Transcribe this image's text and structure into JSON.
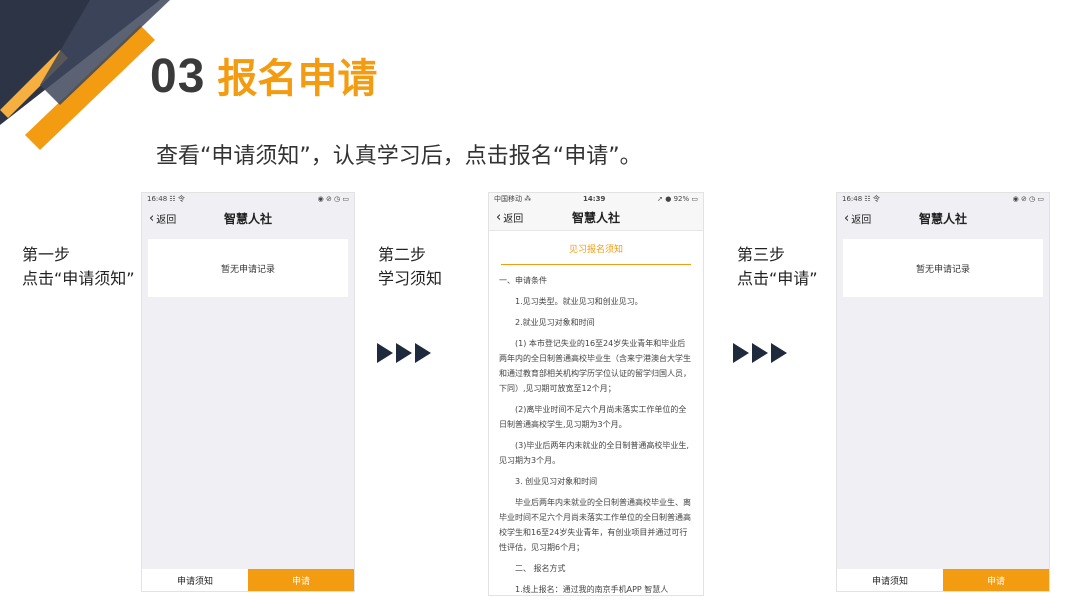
{
  "heading": {
    "number": "03",
    "title": "报名申请"
  },
  "instruction": "查看“申请须知”，认真学习后，点击报名“申请”。",
  "steps": [
    {
      "line1": "第一步",
      "line2": "点击“申请须知”"
    },
    {
      "line1": "第二步",
      "line2": "学习须知"
    },
    {
      "line1": "第三步",
      "line2": "点击“申请”"
    }
  ],
  "colors": {
    "accent": "#f39c12",
    "dark": "#2c3446",
    "text": "#333333"
  },
  "phone1": {
    "status_left": "16:48 ☷ 令",
    "status_right": "◉ ⊘ ◷ ▭",
    "back_label": "返回",
    "title": "智慧人社",
    "empty_text": "暂无申请记录",
    "tabs": {
      "left": "申请须知",
      "right": "申请"
    }
  },
  "phone2": {
    "status_left": "中国移动 ⁂",
    "status_time": "14:39",
    "status_right": "➚ ● 92% ▭",
    "back_label": "返回",
    "title": "智慧人社",
    "doc_title": "见习报名须知",
    "lines": [
      "一、申请条件",
      "1.见习类型。就业见习和创业见习。",
      "2.就业见习对象和时间",
      "(1) 本市登记失业的16至24岁失业青年和毕业后两年内的全日制普通高校毕业生（含来宁港澳台大学生和通过教育部相关机构学历学位认证的留学归国人员，下同）,见习期可放宽至12个月；",
      "(2)离毕业时间不足六个月尚未落实工作单位的全日制普通高校学生,见习期为3个月。",
      "(3)毕业后两年内未就业的全日制普通高校毕业生,见习期为3个月。",
      "3. 创业见习对象和时间",
      "毕业后两年内未就业的全日制普通高校毕业生、离毕业时间不足六个月尚未落实工作单位的全日制普通高校学生和16至24岁失业青年，有创业项目并通过可行性评估，见习期6个月；",
      "二、 报名方式",
      "1.线上报名：通过我的南京手机APP 智慧人"
    ]
  },
  "phone3": {
    "status_left": "16:48 ☷ 令",
    "status_right": "◉ ⊘ ◷ ▭",
    "back_label": "返回",
    "title": "智慧人社",
    "empty_text": "暂无申请记录",
    "tabs": {
      "left": "申请须知",
      "right": "申请"
    }
  }
}
